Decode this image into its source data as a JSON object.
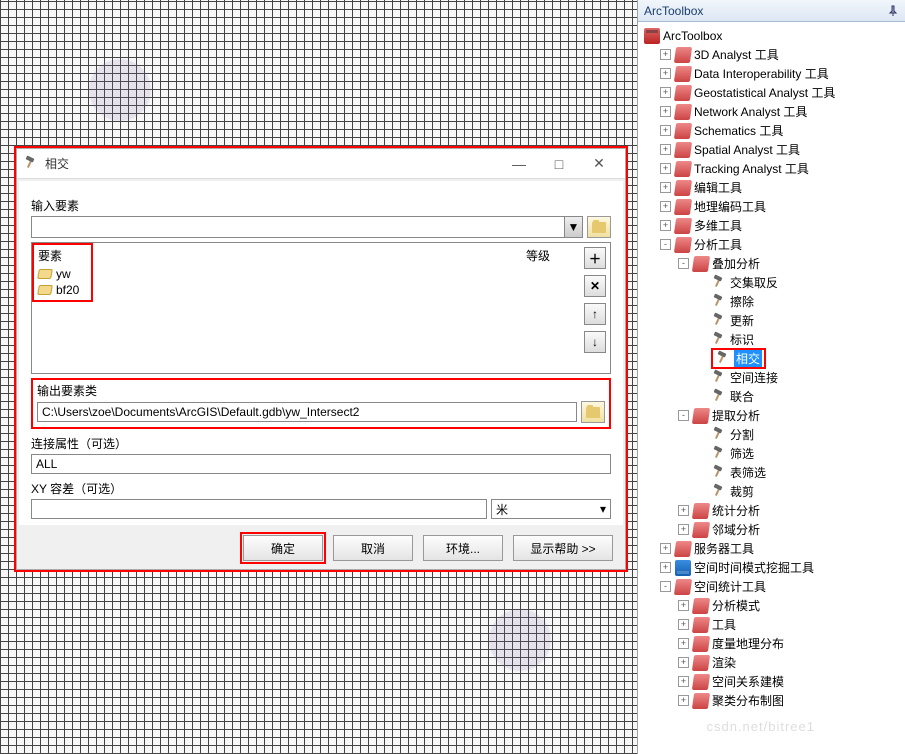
{
  "dialog": {
    "title": "相交",
    "labels": {
      "input_features": "输入要素",
      "feature": "要素",
      "rank": "等级",
      "output_class": "输出要素类",
      "join_attr": "连接属性（可选）",
      "xy_tol": "XY 容差（可选）",
      "unit": "米"
    },
    "input_items": [
      "yw",
      "bf20"
    ],
    "output_path": "C:\\Users\\zoe\\Documents\\ArcGIS\\Default.gdb\\yw_Intersect2",
    "join_attr_value": "ALL",
    "xy_tol_value": "",
    "buttons": {
      "ok": "确定",
      "cancel": "取消",
      "env": "环境...",
      "help": "显示帮助 >>",
      "minimize": "—",
      "maximize": "□",
      "close": "✕",
      "add": "＋",
      "remove": "✕",
      "up": "↑",
      "down": "↓",
      "dropdown": "▼"
    }
  },
  "panel": {
    "title": "ArcToolbox",
    "root": "ArcToolbox",
    "items": [
      {
        "exp": "+",
        "ico": "ico-tbset",
        "lbl": "3D Analyst 工具",
        "indent": 18
      },
      {
        "exp": "+",
        "ico": "ico-tbset",
        "lbl": "Data Interoperability 工具",
        "indent": 18
      },
      {
        "exp": "+",
        "ico": "ico-tbset",
        "lbl": "Geostatistical Analyst 工具",
        "indent": 18
      },
      {
        "exp": "+",
        "ico": "ico-tbset",
        "lbl": "Network Analyst 工具",
        "indent": 18
      },
      {
        "exp": "+",
        "ico": "ico-tbset",
        "lbl": "Schematics 工具",
        "indent": 18
      },
      {
        "exp": "+",
        "ico": "ico-tbset",
        "lbl": "Spatial Analyst 工具",
        "indent": 18
      },
      {
        "exp": "+",
        "ico": "ico-tbset",
        "lbl": "Tracking Analyst 工具",
        "indent": 18
      },
      {
        "exp": "+",
        "ico": "ico-tbset",
        "lbl": "编辑工具",
        "indent": 18
      },
      {
        "exp": "+",
        "ico": "ico-tbset",
        "lbl": "地理编码工具",
        "indent": 18
      },
      {
        "exp": "+",
        "ico": "ico-tbset",
        "lbl": "多维工具",
        "indent": 18
      },
      {
        "exp": "-",
        "ico": "ico-tbset",
        "lbl": "分析工具",
        "indent": 18
      },
      {
        "exp": "-",
        "ico": "ico-tbset",
        "lbl": "叠加分析",
        "indent": 36
      },
      {
        "exp": "",
        "ico": "ico-hammer",
        "lbl": "交集取反",
        "indent": 54
      },
      {
        "exp": "",
        "ico": "ico-hammer",
        "lbl": "擦除",
        "indent": 54
      },
      {
        "exp": "",
        "ico": "ico-hammer",
        "lbl": "更新",
        "indent": 54
      },
      {
        "exp": "",
        "ico": "ico-hammer",
        "lbl": "标识",
        "indent": 54
      },
      {
        "exp": "",
        "ico": "ico-hammer",
        "lbl": "相交",
        "indent": 54,
        "sel": true,
        "red": true
      },
      {
        "exp": "",
        "ico": "ico-hammer",
        "lbl": "空间连接",
        "indent": 54
      },
      {
        "exp": "",
        "ico": "ico-hammer",
        "lbl": "联合",
        "indent": 54
      },
      {
        "exp": "-",
        "ico": "ico-tbset",
        "lbl": "提取分析",
        "indent": 36
      },
      {
        "exp": "",
        "ico": "ico-hammer",
        "lbl": "分割",
        "indent": 54
      },
      {
        "exp": "",
        "ico": "ico-hammer",
        "lbl": "筛选",
        "indent": 54
      },
      {
        "exp": "",
        "ico": "ico-hammer",
        "lbl": "表筛选",
        "indent": 54
      },
      {
        "exp": "",
        "ico": "ico-hammer",
        "lbl": "裁剪",
        "indent": 54
      },
      {
        "exp": "+",
        "ico": "ico-tbset",
        "lbl": "统计分析",
        "indent": 36
      },
      {
        "exp": "+",
        "ico": "ico-tbset",
        "lbl": "邻域分析",
        "indent": 36
      },
      {
        "exp": "+",
        "ico": "ico-tbset",
        "lbl": "服务器工具",
        "indent": 18
      },
      {
        "exp": "+",
        "ico": "ico-drawer",
        "lbl": "空间时间模式挖掘工具",
        "indent": 18
      },
      {
        "exp": "-",
        "ico": "ico-tbset",
        "lbl": "空间统计工具",
        "indent": 18
      },
      {
        "exp": "+",
        "ico": "ico-tbset",
        "lbl": "分析模式",
        "indent": 36
      },
      {
        "exp": "+",
        "ico": "ico-tbset",
        "lbl": "工具",
        "indent": 36
      },
      {
        "exp": "+",
        "ico": "ico-tbset",
        "lbl": "度量地理分布",
        "indent": 36
      },
      {
        "exp": "+",
        "ico": "ico-tbset",
        "lbl": "渲染",
        "indent": 36
      },
      {
        "exp": "+",
        "ico": "ico-tbset",
        "lbl": "空间关系建模",
        "indent": 36
      },
      {
        "exp": "+",
        "ico": "ico-tbset",
        "lbl": "聚类分布制图",
        "indent": 36
      }
    ]
  },
  "watermark": "csdn.net/bitree1"
}
